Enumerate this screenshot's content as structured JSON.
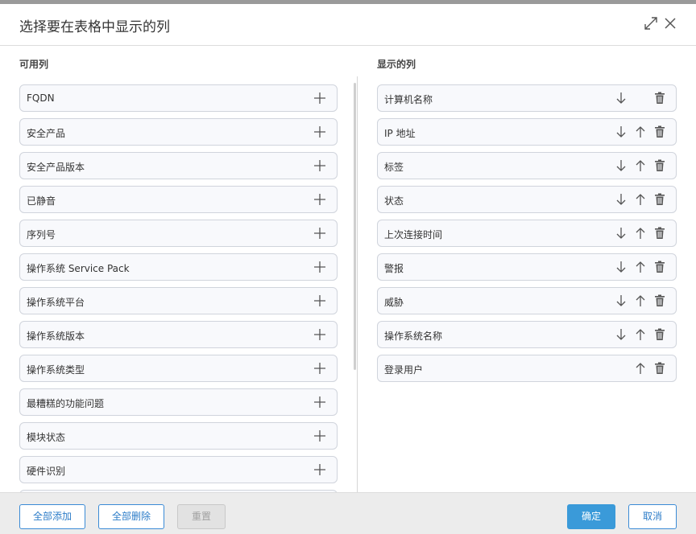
{
  "dialog": {
    "title": "选择要在表格中显示的列",
    "icons": {
      "expand": "expand-icon",
      "close": "close-icon",
      "add": "plus-icon",
      "down": "arrow-down-icon",
      "up": "arrow-up-icon",
      "delete": "trash-icon"
    }
  },
  "available": {
    "label": "可用列",
    "items": [
      "FQDN",
      "安全产品",
      "安全产品版本",
      "已静音",
      "序列号",
      "操作系统 Service Pack",
      "操作系统平台",
      "操作系统版本",
      "操作系统类型",
      "最糟糕的功能问题",
      "模块状态",
      "硬件识别",
      ""
    ]
  },
  "shown": {
    "label": "显示的列",
    "items": [
      {
        "label": "计算机名称",
        "down": true,
        "up": false
      },
      {
        "label": "IP 地址",
        "down": true,
        "up": true
      },
      {
        "label": "标签",
        "down": true,
        "up": true
      },
      {
        "label": "状态",
        "down": true,
        "up": true
      },
      {
        "label": "上次连接时间",
        "down": true,
        "up": true
      },
      {
        "label": "警报",
        "down": true,
        "up": true
      },
      {
        "label": "威胁",
        "down": true,
        "up": true
      },
      {
        "label": "操作系统名称",
        "down": true,
        "up": true
      },
      {
        "label": "登录用户",
        "down": false,
        "up": true
      }
    ]
  },
  "footer": {
    "add_all": "全部添加",
    "remove_all": "全部删除",
    "reset": "重置",
    "confirm": "确定",
    "cancel": "取消"
  }
}
